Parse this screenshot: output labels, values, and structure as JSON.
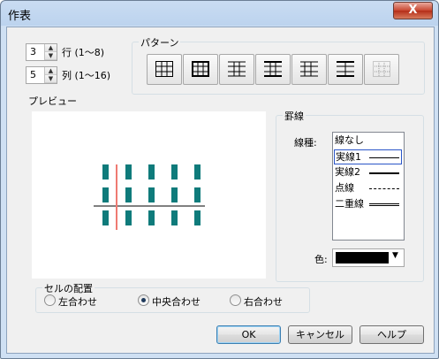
{
  "window": {
    "title": "作表",
    "close_label": "X"
  },
  "rows": {
    "value": "3",
    "label": "行 (1〜8)"
  },
  "cols": {
    "value": "5",
    "label": "列 (1〜16)"
  },
  "pattern": {
    "title": "パターン",
    "patterns": [
      "grid-all",
      "grid-bold-outer",
      "horizontal-lines",
      "horizontal-center-vertical",
      "horizontal-left",
      "horizontal-bold-top",
      "grid-dotted"
    ]
  },
  "preview": {
    "title": "プレビュー"
  },
  "border": {
    "title": "罫線",
    "line_type_label": "線種:",
    "line_types": [
      {
        "label": "線なし",
        "style": "none"
      },
      {
        "label": "実線1",
        "style": "solid-thin"
      },
      {
        "label": "実線2",
        "style": "solid-bold"
      },
      {
        "label": "点線",
        "style": "dotted"
      },
      {
        "label": "二重線",
        "style": "double"
      }
    ],
    "selected_line_type": "実線1",
    "color_label": "色:",
    "color_value": "#000000"
  },
  "alignment": {
    "title": "セルの配置",
    "options": [
      "左合わせ",
      "中央合わせ",
      "右合わせ"
    ],
    "selected": "中央合わせ"
  },
  "buttons": {
    "ok": "OK",
    "cancel": "キャンセル",
    "help": "ヘルプ"
  },
  "colors": {
    "cell": "#0f7b7b",
    "highlight_line": "#ef7a72"
  }
}
